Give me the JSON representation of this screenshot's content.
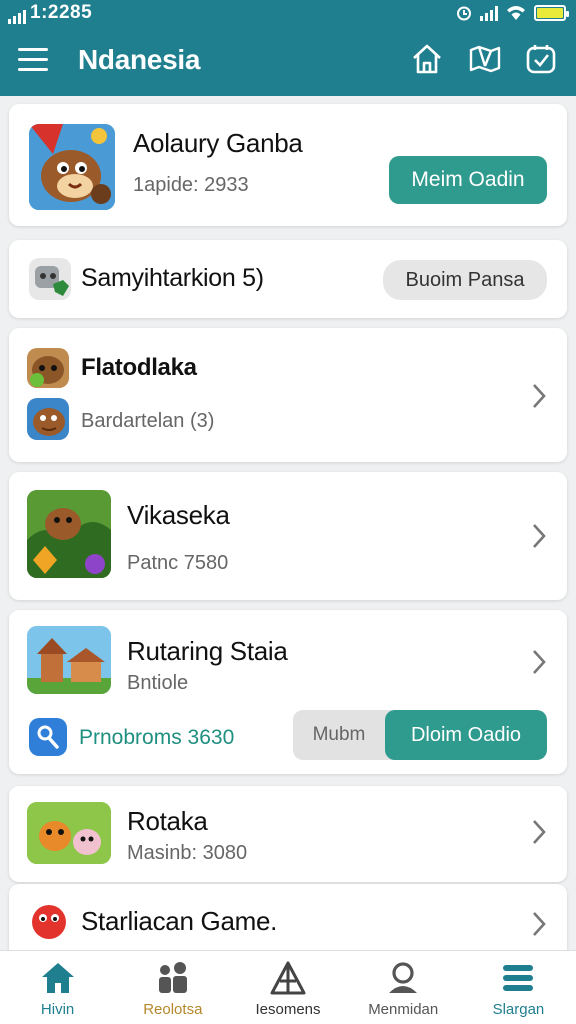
{
  "status": {
    "time": "1:2285",
    "battery_color": "#e9ea3a"
  },
  "appbar": {
    "title": "Ndanesia",
    "bg": "#1f7f8e",
    "icons": [
      "home-icon",
      "map-icon",
      "calendar-check-icon"
    ]
  },
  "cards": [
    {
      "title": "Aolaury Ganba",
      "subtitle": "1apide: 2933",
      "button": "Meim Oadin",
      "icon": "beaver-character-icon"
    },
    {
      "title": "Samyihtarkion 5)",
      "button": "Buoim Pansa",
      "icon": "robot-shield-icon"
    },
    {
      "title": "Flatodlaka",
      "subtitle": "Bardartelan (3)",
      "icon": "bear-icon"
    },
    {
      "title": "Vikaseka",
      "subtitle": "Patnc 7580",
      "icon": "jungle-beaver-icon"
    },
    {
      "title": "Rutaring Staia",
      "subtitle": "Bntiole",
      "promo_label": "Prnobroms 3630",
      "toggle_off": "Mubm",
      "toggle_on": "Dloim Oadio",
      "icon": "temple-icon"
    },
    {
      "title": "Rotaka",
      "subtitle": "Masinb: 3080",
      "icon": "fox-friends-icon"
    },
    {
      "title": "Starliacan Game.",
      "icon": "red-creature-icon"
    }
  ],
  "bottom_nav": [
    {
      "label": "Hivin",
      "color": "#1f7f8e",
      "icon": "house-icon"
    },
    {
      "label": "Reolotsa",
      "color": "#b4882a",
      "icon": "people-icon"
    },
    {
      "label": "Iesomens",
      "color": "#333333",
      "icon": "pyramid-icon"
    },
    {
      "label": "Menmidan",
      "color": "#555555",
      "icon": "user-icon"
    },
    {
      "label": "Slargan",
      "color": "#1f7f8e",
      "icon": "menu-icon"
    }
  ]
}
